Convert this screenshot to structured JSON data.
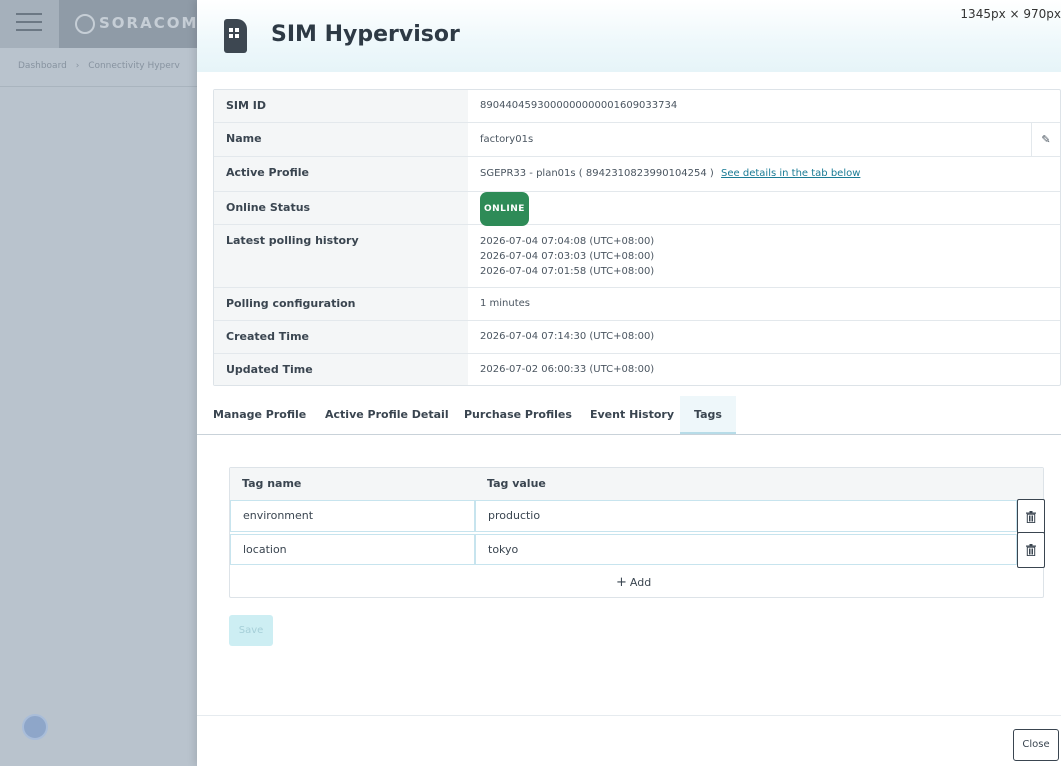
{
  "background": {
    "logo_text": "SORACOM",
    "breadcrumbs": [
      "Dashboard",
      "›",
      "Connectivity Hyperv"
    ]
  },
  "modal": {
    "title": "SIM Hypervisor",
    "dimension_label": "1345px × 970px",
    "info": {
      "sim_id_label": "SIM ID",
      "sim_id": "8904404593000000000001609033734",
      "name_label": "Name",
      "name": "factory01s",
      "active_profile_label": "Active Profile",
      "active_profile": "SGEPR33 - plan01s ( 8942310823990104254 )",
      "active_profile_link": "See details in the tab below",
      "online_status_label": "Online Status",
      "online_status": "ONLINE",
      "polling_history_label": "Latest polling history",
      "polling_history": [
        "2026-07-04 07:04:08 (UTC+08:00)",
        "2026-07-04 07:03:03 (UTC+08:00)",
        "2026-07-04 07:01:58 (UTC+08:00)"
      ],
      "polling_config_label": "Polling configuration",
      "polling_config": "1 minutes",
      "created_time_label": "Created Time",
      "created_time": "2026-07-04 07:14:30 (UTC+08:00)",
      "updated_time_label": "Updated Time",
      "updated_time": "2026-07-02 06:00:33 (UTC+08:00)"
    },
    "tabs": [
      "Manage Profile",
      "Active Profile Detail",
      "Purchase Profiles",
      "Event History",
      "Tags"
    ],
    "active_tab": "Tags",
    "tags": {
      "col_name": "Tag name",
      "col_value": "Tag value",
      "rows": [
        {
          "name": "environment",
          "value": "productio"
        },
        {
          "name": "location",
          "value": "tokyo"
        }
      ],
      "add_label": "Add"
    },
    "save_label": "Save",
    "close_label": "Close"
  }
}
